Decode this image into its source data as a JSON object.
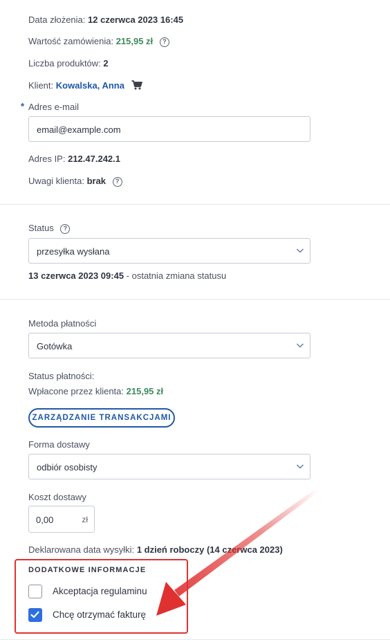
{
  "order": {
    "date_label": "Data złożenia:",
    "date_value": "12 czerwca 2023 16:45",
    "value_label": "Wartość zamówienia:",
    "value_amount": "215,95 zł",
    "products_label": "Liczba produktów:",
    "products_count": "2",
    "client_label": "Klient:",
    "client_name": "Kowalska, Anna",
    "email_label": "Adres e-mail",
    "email_required_mark": "*",
    "email_value": "email@example.com",
    "ip_label": "Adres IP:",
    "ip_value": "212.47.242.1",
    "notes_label": "Uwagi klienta:",
    "notes_value": "brak"
  },
  "status": {
    "label": "Status",
    "selected": "przesyłka wysłana",
    "last_change_date": "13 czerwca 2023 09:45",
    "last_change_suffix": " - ostatnia zmiana statusu"
  },
  "payment": {
    "method_label": "Metoda płatności",
    "method_selected": "Gotówka",
    "status_label": "Status płatności:",
    "paid_label": "Wpłacone przez klienta:",
    "paid_amount": "215,95 zł",
    "manage_button": "ZARZĄDZANIE TRANSAKCJAMI"
  },
  "delivery": {
    "form_label": "Forma dostawy",
    "form_selected": "odbiór osobisty",
    "cost_label": "Koszt dostawy",
    "cost_value": "0,00",
    "cost_unit": "zł",
    "declared_label": "Deklarowana data wysyłki:",
    "declared_value": "1 dzień roboczy (14 czerwca 2023)"
  },
  "additional": {
    "heading": "DODATKOWE INFORMACJE",
    "items": [
      {
        "label": "Akceptacja regulaminu",
        "checked": false
      },
      {
        "label": "Chcę otrzymać fakturę",
        "checked": true
      }
    ]
  },
  "colors": {
    "accent_blue": "#1f58a8",
    "checkbox_blue": "#2d6fe0",
    "money_green": "#3e8a5e",
    "highlight_red": "#e03131"
  },
  "icons": {
    "help": "help-circle-icon",
    "cart": "cart-icon",
    "chevron": "chevron-down-icon",
    "check": "check-icon",
    "arrow": "red-arrow-annotation"
  }
}
